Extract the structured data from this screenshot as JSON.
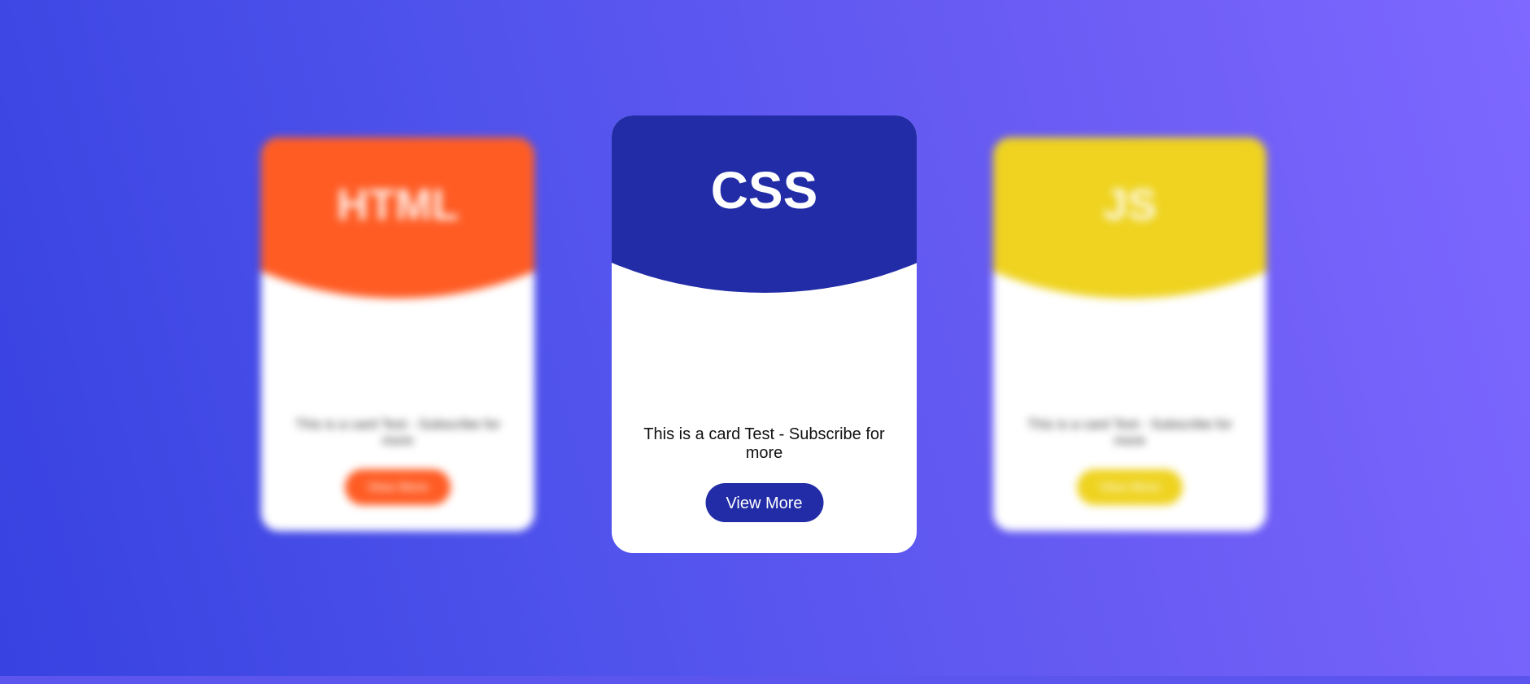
{
  "cards": [
    {
      "title": "HTML",
      "text": "This is a card Test - Subscribe for more",
      "button_label": "View More",
      "color": "#ff5c24"
    },
    {
      "title": "CSS",
      "text": "This is a card Test - Subscribe for more",
      "button_label": "View More",
      "color": "#222ca6"
    },
    {
      "title": "JS",
      "text": "This is a card Test - Subscribe for more",
      "button_label": "View More",
      "color": "#efd320"
    }
  ],
  "colors": {
    "background_start": "#3742e0",
    "background_end": "#7e68ff",
    "card_background": "#ffffff"
  }
}
